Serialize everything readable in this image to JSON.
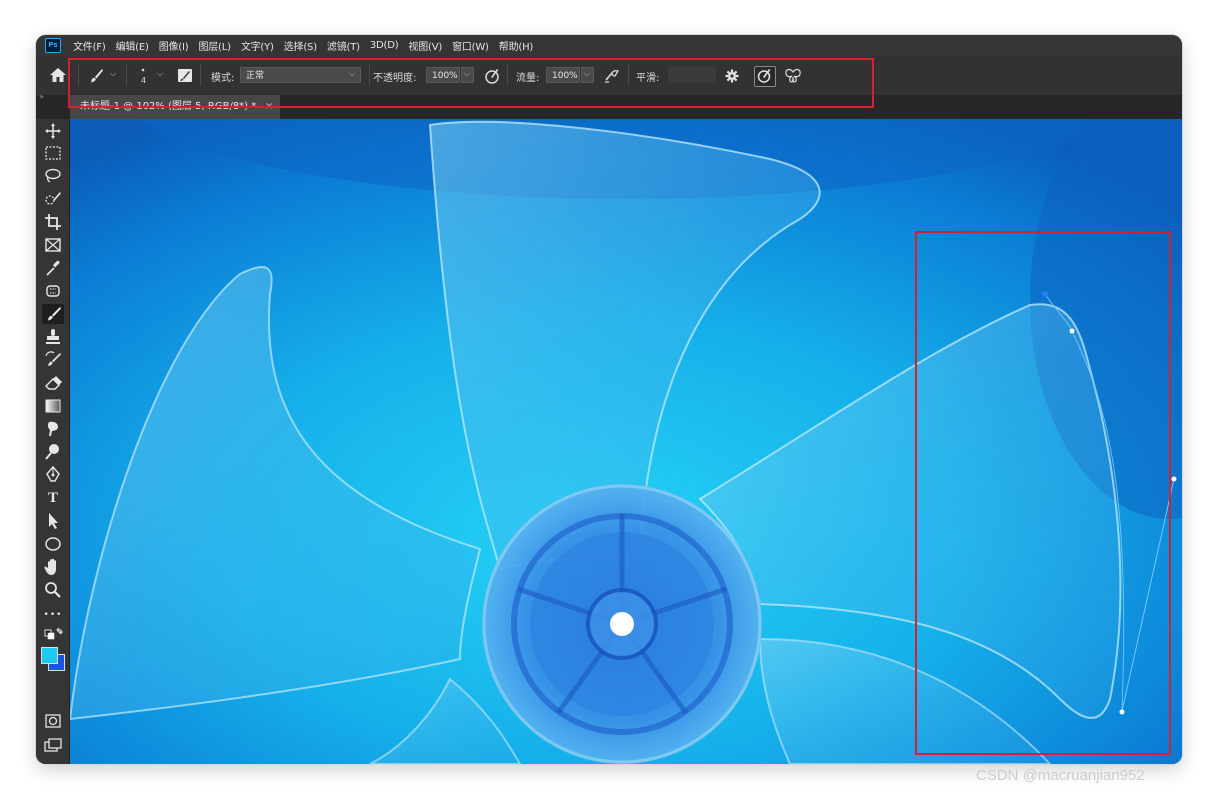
{
  "app": {
    "logo_text": "Ps"
  },
  "menu": [
    "文件(F)",
    "编辑(E)",
    "图像(I)",
    "图层(L)",
    "文字(Y)",
    "选择(S)",
    "滤镜(T)",
    "3D(D)",
    "视图(V)",
    "窗口(W)",
    "帮助(H)"
  ],
  "options_bar": {
    "brush_size": "4",
    "mode_label": "模式:",
    "mode_value": "正常",
    "opacity_label": "不透明度:",
    "opacity_value": "100%",
    "flow_label": "流量:",
    "flow_value": "100%",
    "smoothing_label": "平滑:",
    "smoothing_value": ""
  },
  "document_tab": {
    "title": "未标题-1 @ 102% (图层 5, RGB/8*) *",
    "close": "×"
  },
  "panel_collapse": "»",
  "tools": [
    "move",
    "marquee",
    "lasso",
    "quick-select",
    "crop",
    "frame",
    "eyedropper",
    "patch",
    "brush",
    "stamp",
    "history-brush",
    "eraser",
    "gradient",
    "smudge",
    "dodge",
    "pen",
    "type",
    "path-select",
    "ellipse",
    "hand",
    "zoom",
    "more",
    "swap-colors",
    "color-swatches",
    "quick-mask",
    "screen-mode"
  ],
  "tool_labels": {
    "type": "T",
    "more": "•••"
  },
  "colors": {
    "foreground": "#1ec8f0",
    "background": "#1a56d8",
    "annotation": "#d0232f",
    "ui_dark": "#323232"
  },
  "watermark": "CSDN @macruanjian952"
}
